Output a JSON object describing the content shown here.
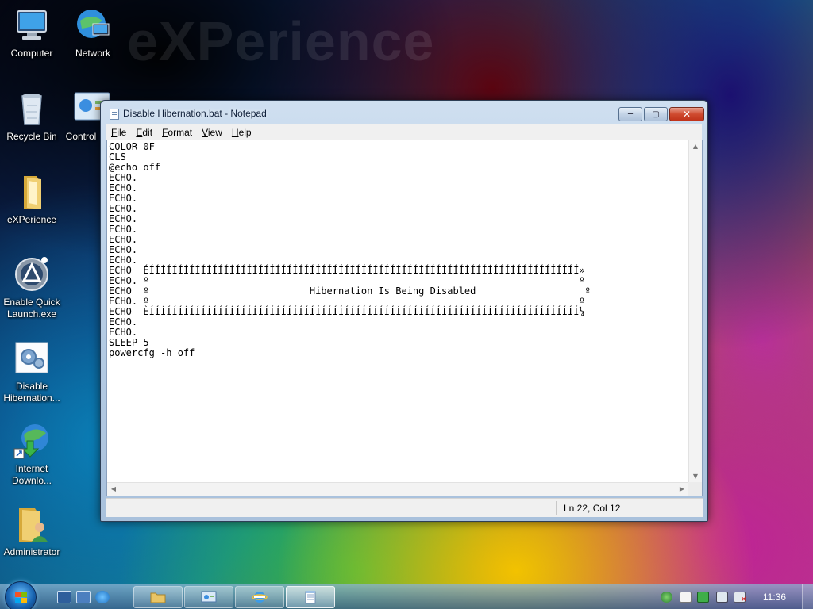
{
  "wallpaper": {
    "brand_text": "eXPerience"
  },
  "desktop_icons": [
    {
      "label": "Computer",
      "icon": "computer-icon"
    },
    {
      "label": "Network",
      "icon": "network-icon"
    },
    {
      "label": "Recycle Bin",
      "icon": "recycle-bin-icon"
    },
    {
      "label": "Control",
      "icon": "control-panel-icon"
    },
    {
      "label": "eXPerience",
      "icon": "folder-icon"
    },
    {
      "label": "Enable Quick Launch.exe",
      "icon": "app-exe-icon"
    },
    {
      "label": "Disable Hibernation...",
      "icon": "batch-file-icon"
    },
    {
      "label": "Internet Downlo...",
      "icon": "internet-download-icon"
    },
    {
      "label": "Administrator",
      "icon": "user-folder-icon"
    }
  ],
  "notepad": {
    "title": "Disable Hibernation.bat - Notepad",
    "menu": [
      "File",
      "Edit",
      "Format",
      "View",
      "Help"
    ],
    "lines": [
      "COLOR 0F",
      "CLS",
      "@echo off",
      "ECHO.",
      "ECHO.",
      "ECHO.",
      "ECHO.",
      "ECHO.",
      "ECHO.",
      "ECHO.",
      "ECHO.",
      "ECHO.",
      "ECHO  ÉÍÍÍÍÍÍÍÍÍÍÍÍÍÍÍÍÍÍÍÍÍÍÍÍÍÍÍÍÍÍÍÍÍÍÍÍÍÍÍÍÍÍÍÍÍÍÍÍÍÍÍÍÍÍÍÍÍÍÍÍÍÍÍÍÍÍÍÍÍÍÍÍÍÍÍ»",
      "ECHO. º                                                                           º",
      "ECHO  º                            Hibernation Is Being Disabled                   º",
      "ECHO. º                                                                           º",
      "ECHO  ÈÍÍÍÍÍÍÍÍÍÍÍÍÍÍÍÍÍÍÍÍÍÍÍÍÍÍÍÍÍÍÍÍÍÍÍÍÍÍÍÍÍÍÍÍÍÍÍÍÍÍÍÍÍÍÍÍÍÍÍÍÍÍÍÍÍÍÍÍÍÍÍÍÍÍÍ¼",
      "ECHO.",
      "ECHO.",
      "SLEEP 5",
      "powercfg -h off"
    ],
    "status_position": "Ln 22, Col 12"
  },
  "taskbar": {
    "clock": "11:36",
    "start_icon": "windows-start-icon",
    "quick_launch": [
      "show-desktop-icon",
      "switch-windows-icon",
      "internet-explorer-icon"
    ],
    "buttons": [
      {
        "icon": "explorer-folder-icon",
        "active": false
      },
      {
        "icon": "control-panel-icon",
        "active": false
      },
      {
        "icon": "internet-explorer-icon",
        "active": false
      },
      {
        "icon": "notepad-icon",
        "active": true
      }
    ],
    "tray": [
      "network-tray-icon",
      "action-center-icon",
      "security-check-icon",
      "network-status-icon",
      "volume-muted-icon"
    ]
  }
}
